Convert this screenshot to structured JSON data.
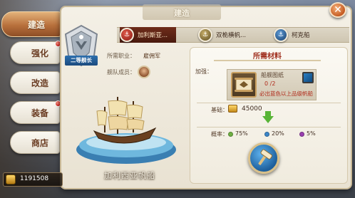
{
  "tabs": [
    {
      "label": "建造",
      "active": true
    },
    {
      "label": "强化",
      "badge": true
    },
    {
      "label": "改造"
    },
    {
      "label": "装备",
      "badge": true
    },
    {
      "label": "商店"
    }
  ],
  "panel": {
    "title": "建造"
  },
  "ships": [
    {
      "label": "加利斯亚...",
      "active": true,
      "icon": "galleon-icon",
      "color": "#b8302a"
    },
    {
      "label": "双桅横帆...",
      "icon": "brig-icon",
      "color": "#7a6a3a"
    },
    {
      "label": "柯克船",
      "icon": "cog-ship-icon",
      "color": "#2a5f94"
    }
  ],
  "rank": {
    "ribbon": "二等舰长"
  },
  "info": {
    "job_label": "所需职业：",
    "job_value": "雇佣军",
    "crew_label": "舰队成员："
  },
  "ship_display": {
    "name": "加利西亚帆船"
  },
  "materials": {
    "header": "所需材料",
    "enhance_label": "加强：",
    "item_name": "船舰图纸",
    "item_count": "0 /2",
    "item_note": "必出蓝色以上品级帆船",
    "base_label": "基础：",
    "base_cost": "45000",
    "rate_label": "概率：",
    "rates": [
      {
        "value": "75%",
        "color": "#6fb043"
      },
      {
        "value": "20%",
        "color": "#3b86c9"
      },
      {
        "value": "5%",
        "color": "#9a3fb0"
      }
    ]
  },
  "currency": {
    "value": "1191508"
  }
}
